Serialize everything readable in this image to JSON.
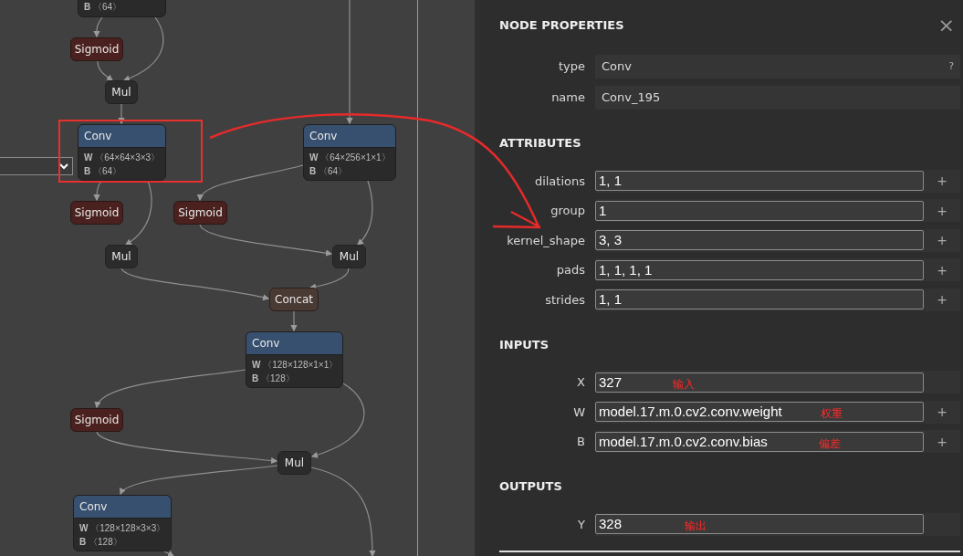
{
  "graph": {
    "nodes": [
      {
        "kind": "conv",
        "b": "**B** 〈64〉"
      },
      {
        "kind": "activation",
        "title": "Sigmoid"
      },
      {
        "kind": "op",
        "title": "Mul"
      },
      {
        "kind": "conv",
        "title": "Conv",
        "w": "**W** 〈64×64×3×3〉",
        "b": "**B** 〈64〉",
        "selected": true
      },
      {
        "kind": "conv",
        "title": "Conv",
        "w": "**W** 〈64×256×1×1〉",
        "b": "**B** 〈64〉",
        "selected": false
      },
      {
        "kind": "activation",
        "title": "Sigmoid"
      },
      {
        "kind": "activation",
        "title": "Sigmoid"
      },
      {
        "kind": "op",
        "title": "Mul"
      },
      {
        "kind": "op",
        "title": "Mul"
      },
      {
        "kind": "concat",
        "title": "Concat"
      },
      {
        "kind": "conv",
        "title": "Conv",
        "w": "**W** 〈128×128×1×1〉",
        "b": "**B** 〈128〉",
        "selected": false
      },
      {
        "kind": "activation",
        "title": "Sigmoid"
      },
      {
        "kind": "op",
        "title": "Mul"
      },
      {
        "kind": "conv",
        "title": "Conv",
        "w": "**W** 〈128×128×3×3〉",
        "b": "**B** 〈128〉",
        "selected": false
      }
    ]
  },
  "panel": {
    "title": "NODE PROPERTIES",
    "close": "×",
    "properties": [
      {
        "label": "type",
        "value": "Conv",
        "help": "?"
      },
      {
        "label": "name",
        "value": "Conv_195"
      }
    ],
    "sections": [
      {
        "title": "ATTRIBUTES",
        "rows": [
          {
            "label": "dilations",
            "value": "1, 1",
            "expand": "+"
          },
          {
            "label": "group",
            "value": "1",
            "expand": "+"
          },
          {
            "label": "kernel_shape",
            "value": "3, 3",
            "expand": "+"
          },
          {
            "label": "pads",
            "value": "1, 1, 1, 1",
            "expand": "+"
          },
          {
            "label": "strides",
            "value": "1, 1",
            "expand": "+"
          }
        ]
      },
      {
        "title": "INPUTS",
        "rows": [
          {
            "label": "X",
            "value": "327",
            "note": "输入"
          },
          {
            "label": "W",
            "value": "model.17.m.0.cv2.conv.weight",
            "expand": "+",
            "note": "权重"
          },
          {
            "label": "B",
            "value": "model.17.m.0.cv2.conv.bias",
            "expand": "+",
            "note": "偏差"
          }
        ]
      },
      {
        "title": "OUTPUTS",
        "rows": [
          {
            "label": "Y",
            "value": "328",
            "note": "输出"
          }
        ]
      }
    ]
  }
}
